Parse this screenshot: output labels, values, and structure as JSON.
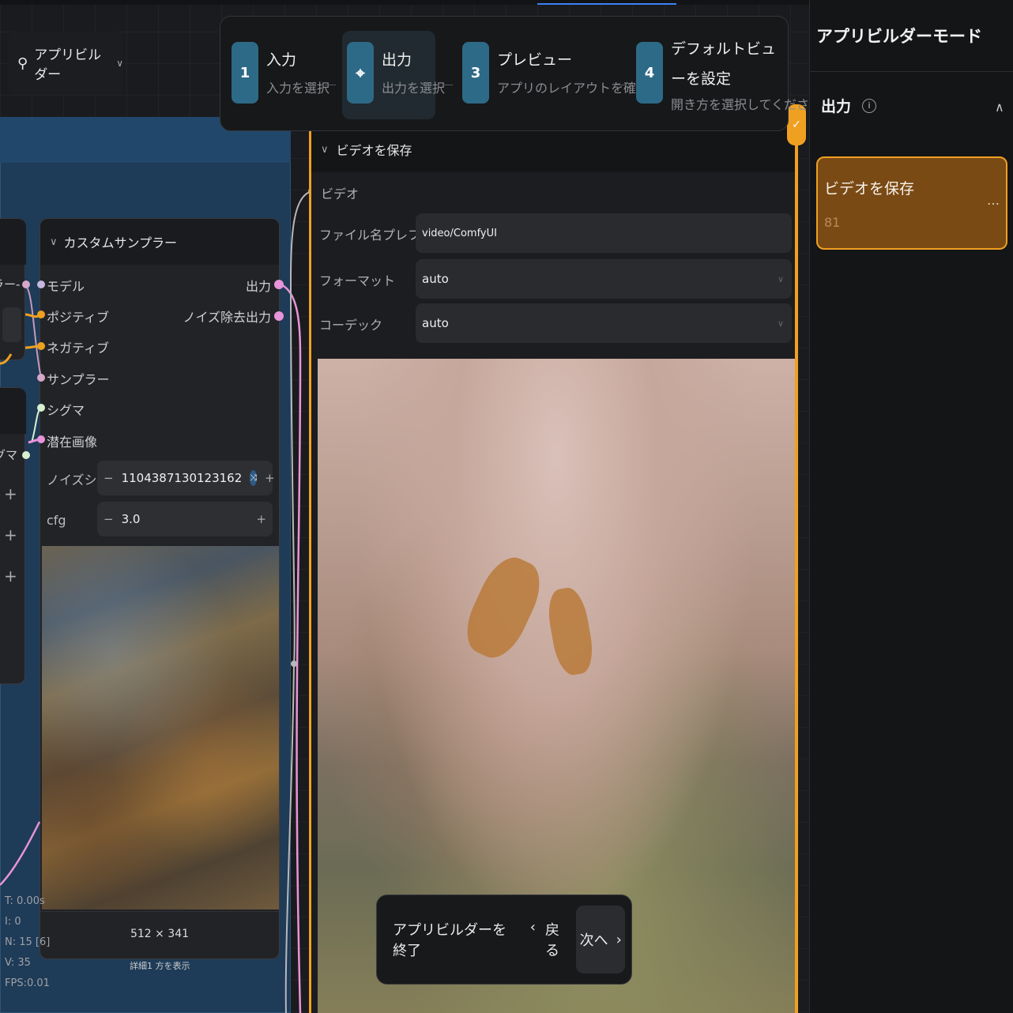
{
  "top_left": {
    "label": "アプリビルダー",
    "chevron": "∨"
  },
  "stepper": {
    "steps": [
      {
        "num": "1",
        "title": "入力",
        "sub": "入力を選択"
      },
      {
        "num": "",
        "title": "出力",
        "sub": "出力を選択"
      },
      {
        "num": "3",
        "title": "プレビュー",
        "sub": "アプリのレイアウトを確認"
      },
      {
        "num": "4",
        "title": "デフォルトビューを設定",
        "sub": "開き方を選択してください"
      }
    ]
  },
  "partial_nodes": {
    "node1_label": "ブラー-",
    "node2_label": "シグマ"
  },
  "sampler": {
    "title": "カスタムサンプラー",
    "inputs": [
      "モデル",
      "ポジティブ",
      "ネガティブ",
      "サンプラー",
      "シグマ",
      "潜在画像"
    ],
    "outputs": [
      "出力",
      "ノイズ除去出力"
    ],
    "noise_seed_label": "ノイズシード",
    "noise_seed_value": "1104387130123162",
    "cfg_label": "cfg",
    "cfg_value": "3.0",
    "preview_size": "512 × 341",
    "footer_text": "詳細1 方を表示"
  },
  "save_video": {
    "title": "ビデオを保存",
    "video_input": "ビデオ",
    "filename_prefix_label": "ファイル名プレフィックス",
    "filename_prefix_value": "video/ComfyUI",
    "format_label": "フォーマット",
    "format_value": "auto",
    "codec_label": "コーデック",
    "codec_value": "auto"
  },
  "bottom_bar": {
    "exit": "アプリビルダーを終了",
    "back": "戻る",
    "next": "次へ"
  },
  "stats": [
    "T: 0.00s",
    "I: 0",
    "N: 15 [6]",
    "V: 35",
    "FPS:0.01"
  ],
  "sidebar": {
    "title": "アプリビルダーモード",
    "section": "出力",
    "card_title": "ビデオを保存",
    "card_id": "81",
    "card_more": "…"
  },
  "colors": {
    "accent_orange": "#f0a020",
    "step_teal": "#2d6a87",
    "group_blue": "#1e3b57"
  }
}
